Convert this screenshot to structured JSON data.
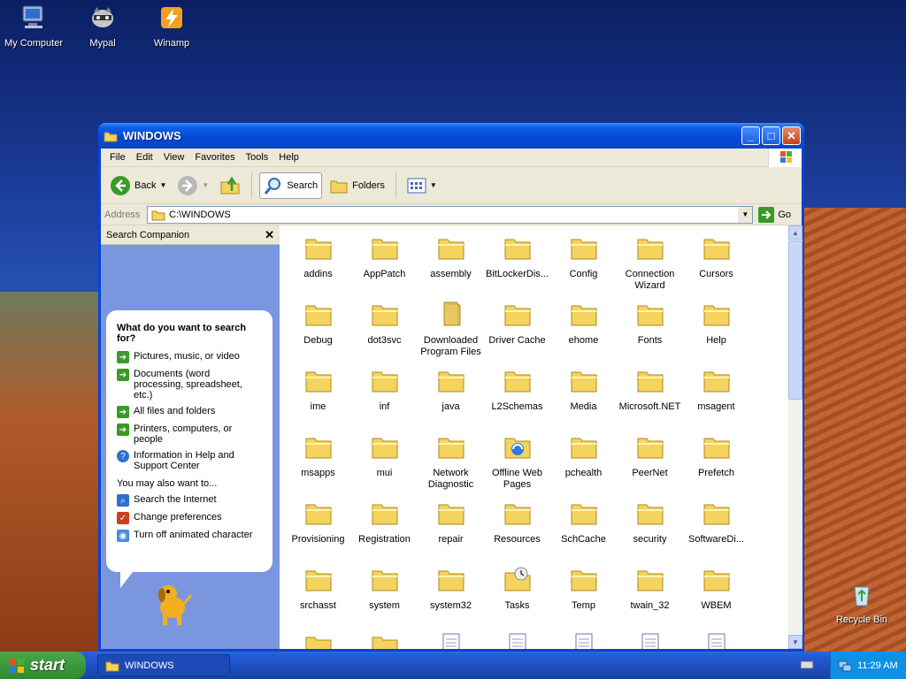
{
  "desktop": {
    "icons": [
      "My Computer",
      "Mypal",
      "Winamp",
      "Recycle Bin"
    ]
  },
  "window": {
    "title": "WINDOWS",
    "menu": [
      "File",
      "Edit",
      "View",
      "Favorites",
      "Tools",
      "Help"
    ],
    "toolbar": {
      "back": "Back",
      "search": "Search",
      "folders": "Folders"
    },
    "address": {
      "label": "Address",
      "value": "C:\\WINDOWS",
      "go": "Go"
    }
  },
  "search_companion": {
    "title": "Search Companion",
    "question": "What do you want to search for?",
    "options": [
      "Pictures, music, or video",
      "Documents (word processing, spreadsheet, etc.)",
      "All files and folders",
      "Printers, computers, or people",
      "Information in Help and Support Center"
    ],
    "also_label": "You may also want to...",
    "also": [
      "Search the Internet",
      "Change preferences",
      "Turn off animated character"
    ]
  },
  "files": [
    "addins",
    "AppPatch",
    "assembly",
    "BitLockerDis...",
    "Config",
    "Connection Wizard",
    "Cursors",
    "Debug",
    "dot3svc",
    "Downloaded Program Files",
    "Driver Cache",
    "ehome",
    "Fonts",
    "Help",
    "ime",
    "inf",
    "java",
    "L2Schemas",
    "Media",
    "Microsoft.NET",
    "msagent",
    "msapps",
    "mui",
    "Network Diagnostic",
    "Offline Web Pages",
    "pchealth",
    "PeerNet",
    "Prefetch",
    "Provisioning",
    "Registration",
    "repair",
    "Resources",
    "SchCache",
    "security",
    "SoftwareDi...",
    "srchasst",
    "system",
    "system32",
    "Tasks",
    "Temp",
    "twain_32",
    "WBEM"
  ],
  "taskbar": {
    "start": "start",
    "window_button": "WINDOWS",
    "clock": "11:29 AM"
  },
  "colors": {
    "folder": "#f4d35e",
    "accent_green": "#3a9a28",
    "title_blue": "#0548d6"
  }
}
